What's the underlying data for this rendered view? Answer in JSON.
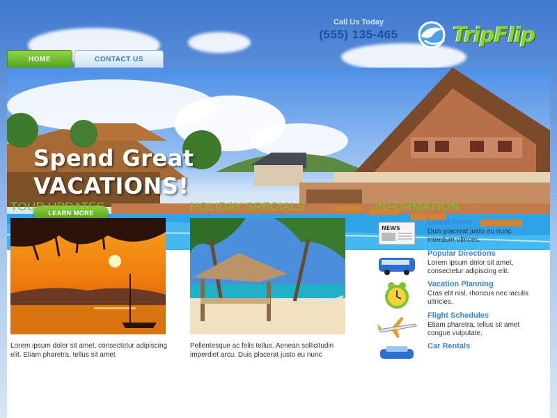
{
  "header": {
    "call_label": "Call Us Today",
    "phone": "(555) 135-465",
    "logo_text": "TripFlip"
  },
  "nav": {
    "tabs": [
      {
        "label": "HOME",
        "active": true
      },
      {
        "label": "CONTACT US",
        "active": false
      }
    ]
  },
  "hero": {
    "title_line1": "Spend Great",
    "title_line2": "VACATIONS!",
    "button_label": "LEARN MORE"
  },
  "columns": {
    "tour": {
      "heading": "TOUR UPDATES",
      "text": "Lorem ipsum dolor sit amet, consectetur adipiscing elit. Etiam pharetra, tellus sit amet"
    },
    "holiday": {
      "heading": "HOLIDAY SPECIALS",
      "text": "Pellentesque ac felis tellus. Aenean sollicitudin imperdiet arcu. Duis placerat justo eu nunc"
    },
    "info": {
      "heading": "INFORMATION",
      "items": [
        {
          "title": "Latest News",
          "desc": "Duis placerat justo eu nunc interdum ultrices.",
          "icon": "newspaper-icon"
        },
        {
          "title": "Popular Directions",
          "desc": "Lorem ipsum dolor sit amet, consectetur adipiscing elit.",
          "icon": "bus-icon"
        },
        {
          "title": "Vacation Planning",
          "desc": "Cras elit nisl, rhoncus nec iaculis ultricies.",
          "icon": "alarm-clock-icon"
        },
        {
          "title": "Flight Schedules",
          "desc": "Etiam pharetra, tellus sit amet congue vulputate.",
          "icon": "airplane-icon"
        },
        {
          "title": "Car Rentals",
          "desc": "",
          "icon": "car-icon"
        }
      ]
    }
  },
  "colors": {
    "accent_green": "#7cc231",
    "link_blue": "#3a86d8",
    "phone_blue": "#1d4fa0"
  }
}
